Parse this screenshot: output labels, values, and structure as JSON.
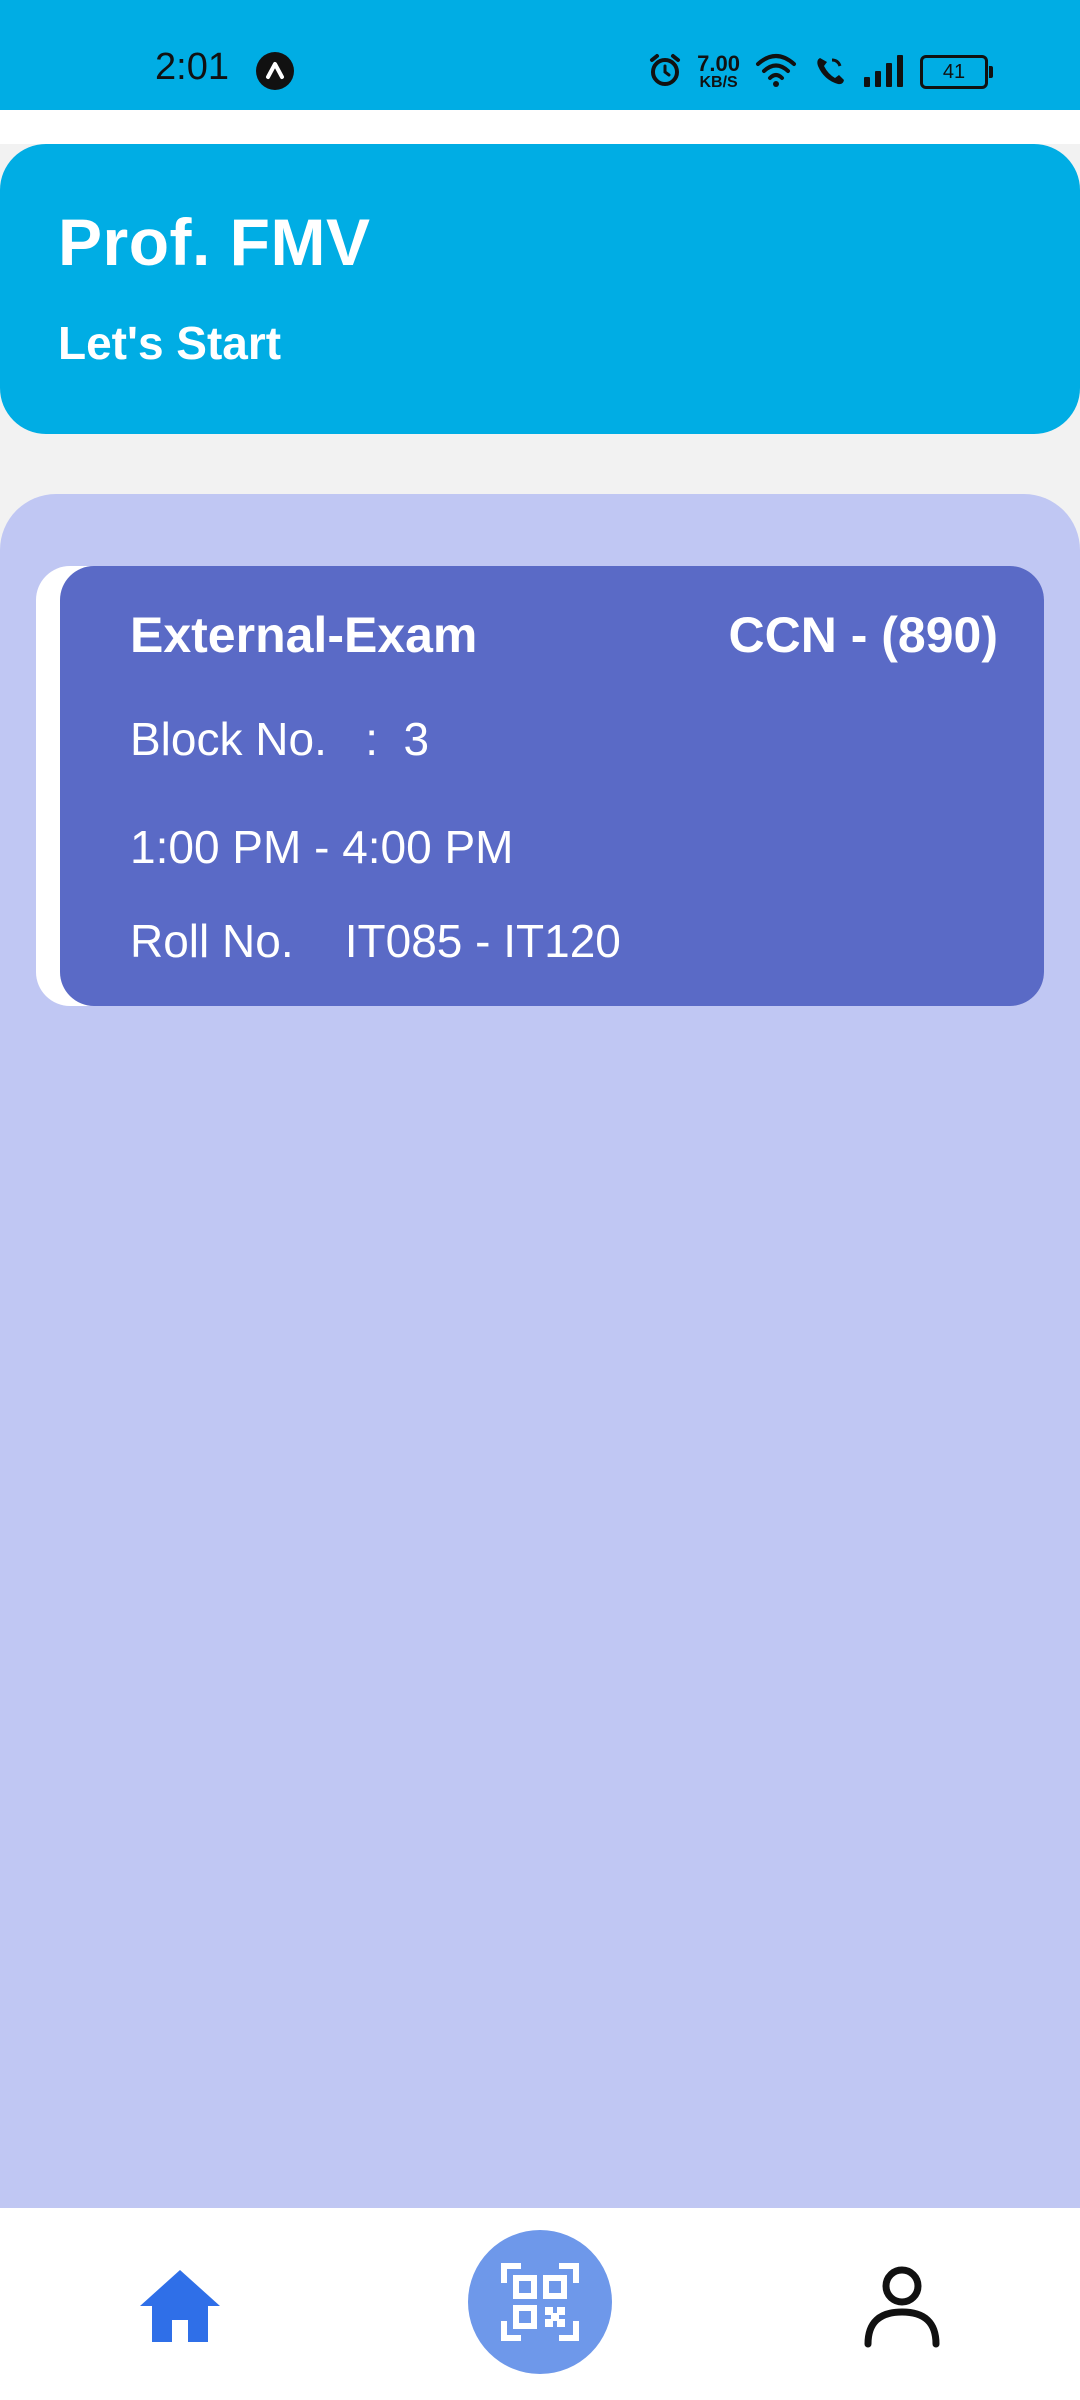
{
  "status_bar": {
    "time": "2:01",
    "speed_value": "7.00",
    "speed_unit": "KB/S",
    "battery": "41"
  },
  "header": {
    "title": "Prof.  FMV",
    "subtitle": "Let's Start"
  },
  "exam_card": {
    "type": "External-Exam",
    "course_code": "CCN - (890)",
    "block": "Block No.   :  3",
    "time": "1:00 PM - 4:00 PM",
    "roll": "Roll No.    IT085 - IT120"
  },
  "colors": {
    "primary": "#00ade4",
    "panel": "#c0c7f3",
    "card": "#5a6ac6",
    "nav_active": "#2f6fe8",
    "qr_button": "#6e98ea"
  },
  "bottom_nav": {
    "items": [
      "home-icon",
      "qr-scan-icon",
      "profile-icon"
    ]
  }
}
